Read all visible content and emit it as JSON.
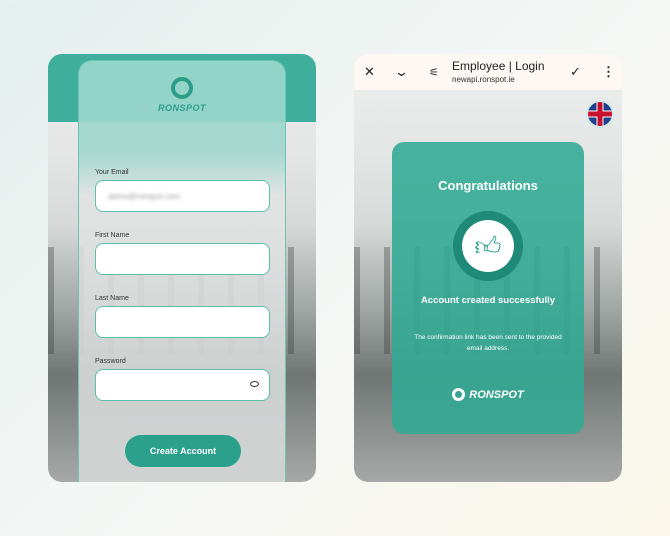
{
  "signup": {
    "brand": "RONSPOT",
    "fields": [
      {
        "label": "Your Email",
        "value": "demo@ronspot.com"
      },
      {
        "label": "First Name",
        "value": ""
      },
      {
        "label": "Last Name",
        "value": ""
      },
      {
        "label": "Password",
        "value": ""
      }
    ],
    "submit_label": "Create Account"
  },
  "browser": {
    "title": "Employee | Login",
    "url": "newapi.ronspot.ie"
  },
  "success": {
    "title": "Congratulations",
    "subtitle": "Account created successfully",
    "message": "The confirmation link has been sent to the provided email address.",
    "brand": "RONSPOT"
  },
  "colors": {
    "accent": "#2ba08c",
    "browser_bar": "#fdf8f3"
  }
}
